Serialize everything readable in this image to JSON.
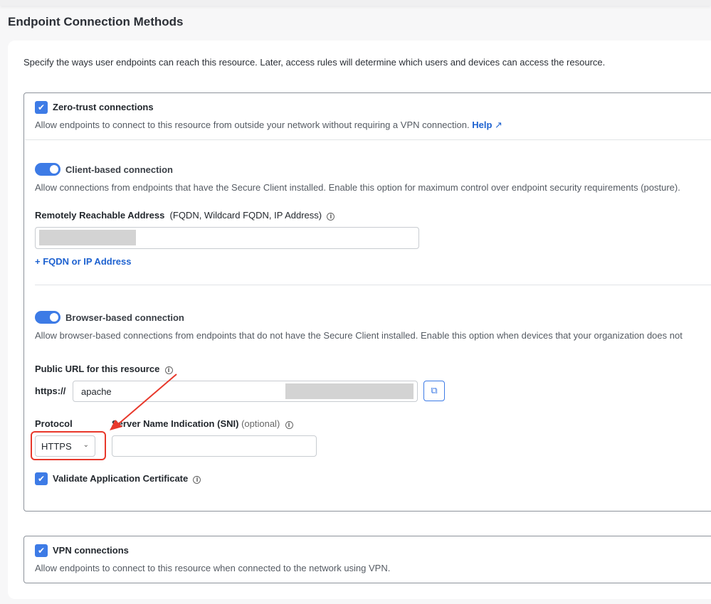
{
  "page_title": "Endpoint Connection Methods",
  "intro": "Specify the ways user endpoints can reach this resource. Later, access rules will determine which users and devices can access the resource.",
  "zero_trust": {
    "label": "Zero-trust connections",
    "checked": true,
    "description": "Allow endpoints to connect to this resource from outside your network without requiring a VPN connection.",
    "help_link": "Help",
    "icon": "external-link-icon"
  },
  "client_based": {
    "label": "Client-based connection",
    "enabled": true,
    "description": "Allow connections from endpoints that have the Secure Client installed. Enable this option for maximum control over endpoint security requirements (posture).",
    "address_label": "Remotely Reachable Address",
    "address_hint": "(FQDN, Wildcard FQDN, IP Address)",
    "address_value": "",
    "add_link": "+ FQDN or IP Address"
  },
  "browser_based": {
    "label": "Browser-based connection",
    "enabled": true,
    "description": "Allow browser-based connections from endpoints that do not have the Secure Client installed. Enable this option when devices that your organization does not",
    "public_url_label": "Public URL for this resource",
    "url_prefix": "https://",
    "url_value": "apache",
    "protocol_label": "Protocol",
    "protocol_value": "HTTPS",
    "sni_label": "Server Name Indication (SNI)",
    "sni_optional": "(optional)",
    "sni_value": "",
    "validate_label": "Validate Application Certificate",
    "validate_checked": true
  },
  "vpn": {
    "label": "VPN connections",
    "checked": true,
    "description": "Allow endpoints to connect to this resource when connected to the network using VPN."
  },
  "colors": {
    "accent": "#3d7be6",
    "link": "#1e62d0",
    "annotation": "#e8382b"
  }
}
